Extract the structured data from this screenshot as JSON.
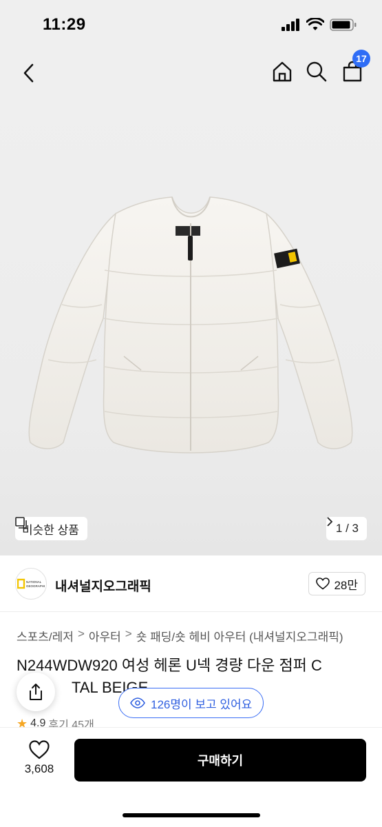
{
  "status_bar": {
    "time": "11:29"
  },
  "nav": {
    "cart_count": "17"
  },
  "hero": {
    "similar_label": "비슷한 상품",
    "pager": "1 / 3"
  },
  "brand": {
    "name": "내셔널지오그래픽",
    "logo_text": "NATIONAL GEOGRAPHIC",
    "likes": "28만"
  },
  "breadcrumb": [
    "스포츠/레저",
    "아우터",
    "숏 패딩/숏 헤비 아우터 (내셔널지오그래픽)"
  ],
  "product": {
    "title": "N244WDW920 여성 헤론 U넥 경량 다운 점퍼 C",
    "title_line2": "TAL BEIGE"
  },
  "rating": {
    "score": "4.9",
    "reviews": "후기 45개"
  },
  "viewers": {
    "text": "126명이 보고 있어요"
  },
  "bottom": {
    "wish_count": "3,608",
    "buy_label": "구매하기"
  },
  "colors": {
    "accent": "#2f6df6",
    "buy": "#000000"
  },
  "icons": [
    "back-icon",
    "home-icon",
    "search-icon",
    "cart-icon",
    "similar-icon",
    "chevron-right-icon",
    "heart-icon",
    "share-icon",
    "eye-icon",
    "star-icon"
  ]
}
